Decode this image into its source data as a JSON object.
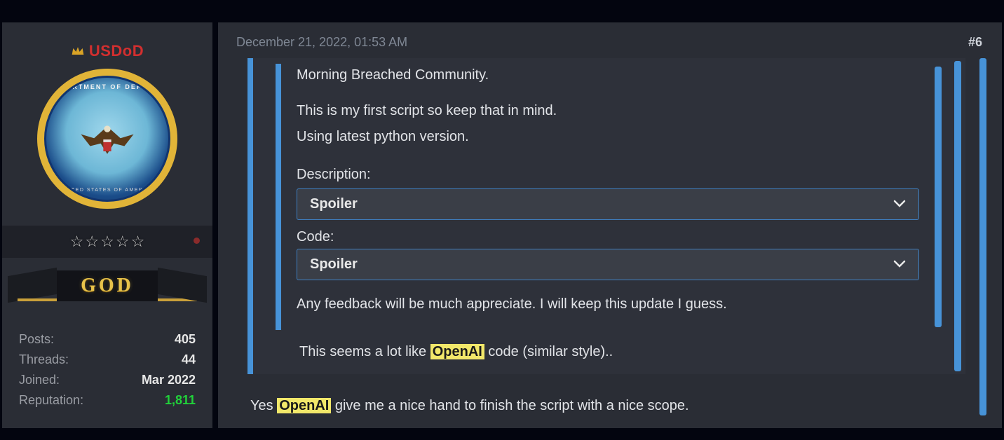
{
  "user": {
    "name": "USDoD",
    "seal_top": "DEPARTMENT OF DEFENSE",
    "seal_bottom": "UNITED STATES OF AMERICA",
    "rank_label": "GOD",
    "stars": 5
  },
  "stats": {
    "posts_label": "Posts:",
    "posts_value": "405",
    "threads_label": "Threads:",
    "threads_value": "44",
    "joined_label": "Joined:",
    "joined_value": "Mar 2022",
    "rep_label": "Reputation:",
    "rep_value": "1,811"
  },
  "post": {
    "timestamp": "December 21, 2022, 01:53 AM",
    "number": "#6",
    "line1": "Morning Breached Community.",
    "line2": "This is my first script so keep that in mind.",
    "line3": "Using latest python version.",
    "desc_label": "Description:",
    "code_label": "Code:",
    "spoiler_label": "Spoiler",
    "feedback": "Any feedback will be much appreciate. I will keep this update I guess.",
    "reply_outer_pre": "This seems a lot like ",
    "reply_outer_hl": "OpenAI",
    "reply_outer_post": " code (similar style)..",
    "reply_bottom_pre": "Yes ",
    "reply_bottom_hl": "OpenAI",
    "reply_bottom_post": " give me a nice hand to finish the script with a nice scope."
  }
}
